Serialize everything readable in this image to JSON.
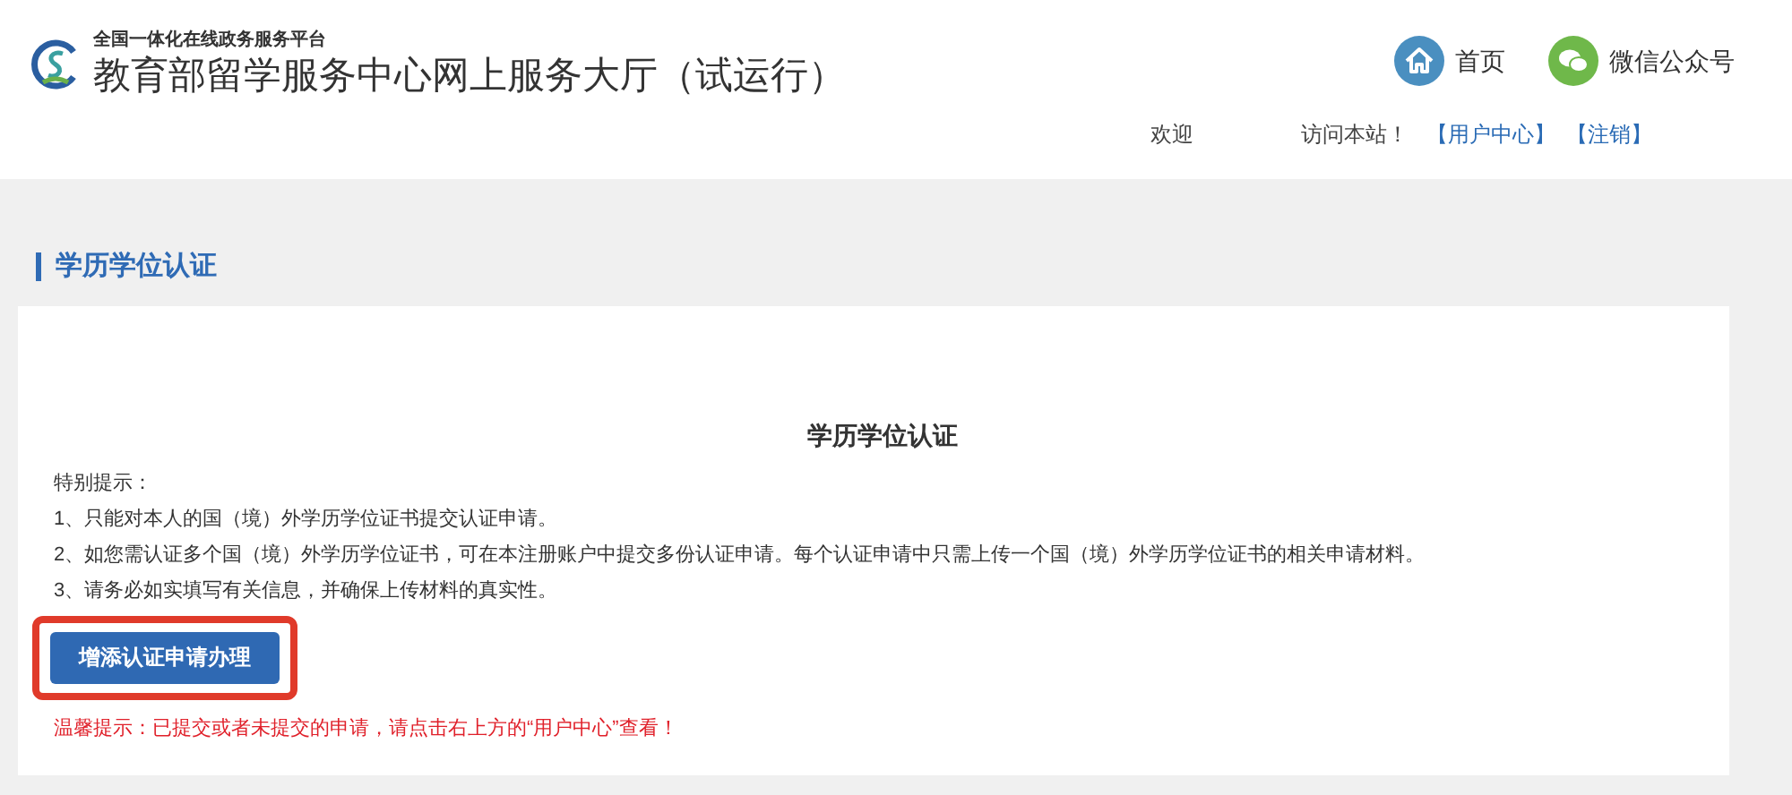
{
  "header": {
    "platform": "全国一体化在线政务服务平台",
    "title": "教育部留学服务中心网上服务大厅（试运行）",
    "nav": [
      {
        "label": "首页",
        "kind": "home"
      },
      {
        "label": "微信公众号",
        "kind": "chat"
      }
    ],
    "welcome": "欢迎",
    "visit": "访问本站！",
    "links": [
      "【用户中心】",
      "【注销】"
    ]
  },
  "section_title": "学历学位认证",
  "card": {
    "title": "学历学位认证",
    "notice_heading": "特别提示：",
    "notices": [
      "1、只能对本人的国（境）外学历学位证书提交认证申请。",
      "2、如您需认证多个国（境）外学历学位证书，可在本注册账户中提交多份认证申请。每个认证申请中只需上传一个国（境）外学历学位证书的相关申请材料。",
      "3、请务必如实填写有关信息，并确保上传材料的真实性。"
    ],
    "button": {
      "label": "增添认证申请办理",
      "highlighted": true
    },
    "tip": "温馨提示：已提交或者未提交的申请，请点击右上方的“用户中心”查看！"
  }
}
